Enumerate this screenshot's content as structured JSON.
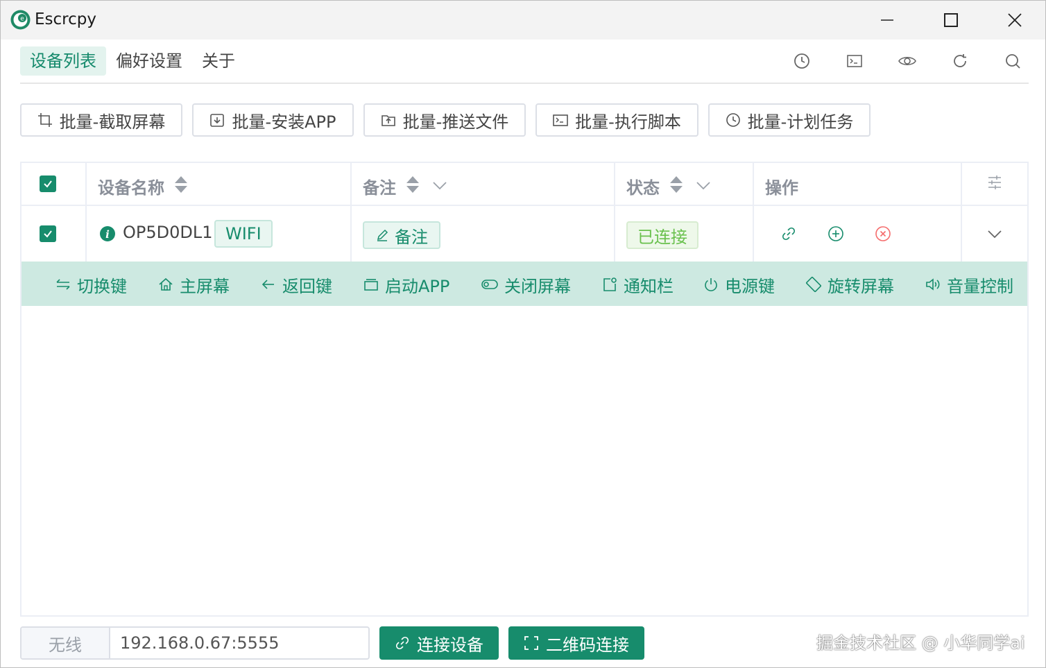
{
  "window": {
    "title": "Escrcpy"
  },
  "nav": {
    "tabs": [
      "设备列表",
      "偏好设置",
      "关于"
    ],
    "active": 0
  },
  "top_icons": [
    "clock-icon",
    "terminal-icon",
    "eye-icon",
    "refresh-icon",
    "search-icon"
  ],
  "batch": {
    "screenshot": "批量-截取屏幕",
    "install": "批量-安装APP",
    "push": "批量-推送文件",
    "script": "批量-执行脚本",
    "schedule": "批量-计划任务"
  },
  "table": {
    "headers": {
      "name": "设备名称",
      "note": "备注",
      "status": "状态",
      "actions": "操作"
    },
    "rows": [
      {
        "name": "OP5D0DL1",
        "tag": "WIFI",
        "note_label": "备注",
        "status": "已连接",
        "checked": true
      }
    ]
  },
  "controls": [
    "切换键",
    "主屏幕",
    "返回键",
    "启动APP",
    "关闭屏幕",
    "通知栏",
    "电源键",
    "旋转屏幕",
    "音量控制"
  ],
  "bottom": {
    "prefix": "无线",
    "address": "192.168.0.67:5555",
    "connect_label": "连接设备",
    "qr_label": "二维码连接"
  },
  "watermark": "掘金技术社区 @ 小华同学ai",
  "colors": {
    "accent": "#178c6c",
    "accent_light": "#cde9e1",
    "success": "#6ac14e",
    "danger": "#f56c6c"
  }
}
